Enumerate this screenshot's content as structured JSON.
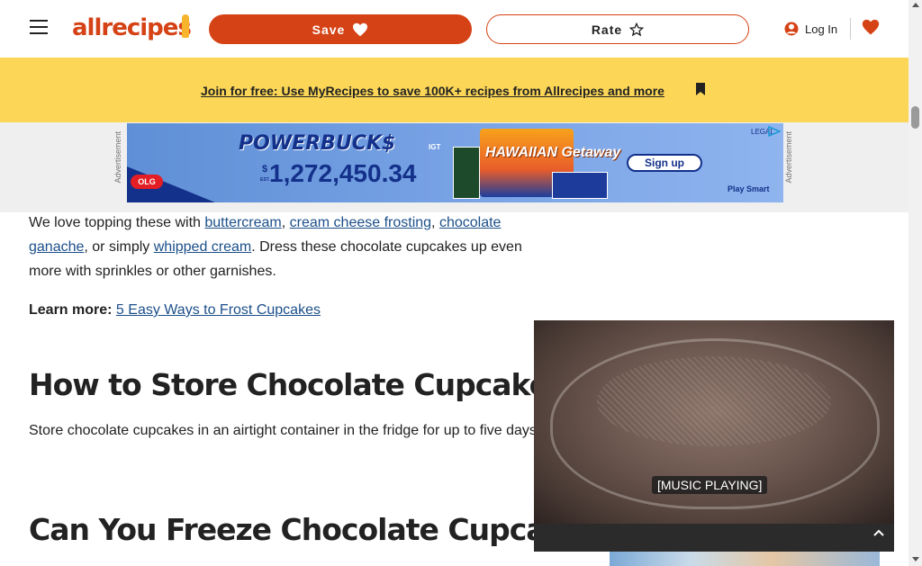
{
  "header": {
    "menu_icon": "hamburger-icon",
    "logo_text": "allrecipes",
    "save_label": "Save",
    "save_icon": "heart-icon",
    "rate_label": "Rate",
    "rate_icon": "star-icon",
    "login_label": "Log In",
    "login_icon": "user-icon",
    "saved_icon": "heart-icon",
    "brand_color": "#d54215"
  },
  "promo": {
    "link_text": "Join for free: Use MyRecipes to save 100K+ recipes from Allrecipes and more",
    "bg_color": "#fcd757"
  },
  "ad": {
    "side_label": "Advertisement",
    "olg": "OLG",
    "brand": "POWERBUCK$",
    "igt": "IGT",
    "currency": "$",
    "est": "EST.",
    "jackpot": "1,272,450.34",
    "hawaiian": "HAWAIIAN Getaway",
    "signup": "Sign up",
    "play_smart": "Play Smart",
    "legal": "LEGAL"
  },
  "article": {
    "p1_pre": "We love topping these with ",
    "link_buttercream": "buttercream",
    "sep1": ", ",
    "link_cream_cheese": "cream cheese frosting",
    "sep2": ", ",
    "link_ganache": "chocolate ganache",
    "mid": ", or simply ",
    "link_whipped": "whipped cream",
    "p1_post": ". Dress these chocolate cupcakes up even more with sprinkles or other garnishes.",
    "learn_label": "Learn more:",
    "learn_link": "5 Easy Ways to Frost Cupcakes",
    "h2_store": "How to Store Chocolate Cupcakes",
    "p_store": "Store chocolate cupcakes in an airtight container in the fridge for up to five days.",
    "h2_freeze": "Can You Freeze Chocolate Cupcakes?"
  },
  "video": {
    "caption": "[MUSIC PLAYING]",
    "close_icon": "close-icon"
  }
}
